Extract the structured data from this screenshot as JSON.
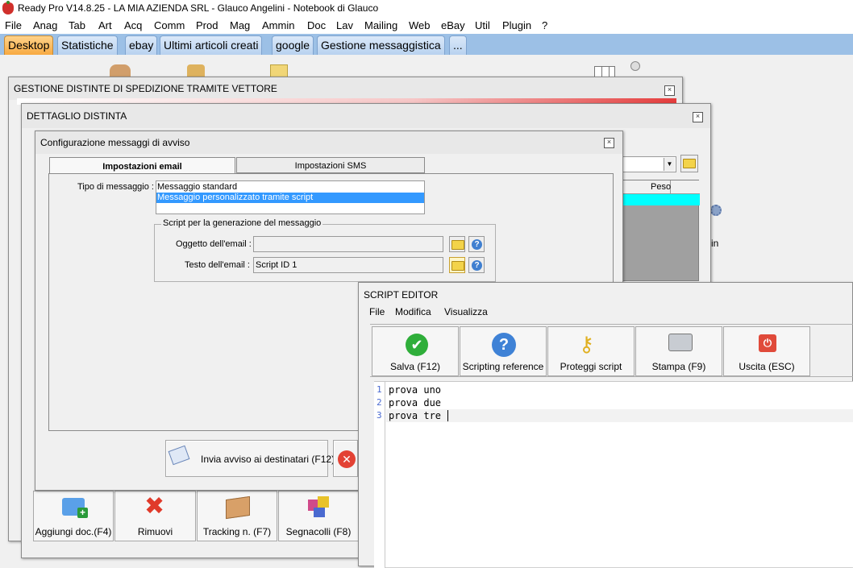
{
  "app": {
    "title": "Ready Pro V14.8.25 - LA MIA AZIENDA SRL - Glauco Angelini - Notebook di Glauco",
    "icon": "strawberry-icon"
  },
  "menu": [
    "File",
    "Anag",
    "Tab",
    "Art",
    "Acq",
    "Comm",
    "Prod",
    "Mag",
    "Ammin",
    "Doc",
    "Lav",
    "Mailing",
    "Web",
    "eBay",
    "Util",
    "Plugin",
    "?"
  ],
  "tabs": [
    "Desktop",
    "Statistiche",
    "ebay",
    "Ultimi articoli creati",
    "google",
    "Gestione messaggistica",
    "..."
  ],
  "win_distinte": {
    "title": "GESTIONE DISTINTE DI SPEDIZIONE TRAMITE VETTORE"
  },
  "win_dettaglio": {
    "title": "DETTAGLIO DISTINTA",
    "column_peso": "Peso",
    "partial_text": "in",
    "bottom_buttons": [
      "Aggiungi doc.(F4)",
      "Rimuovi",
      "Tracking n. (F7)",
      "Segnacolli (F8)"
    ]
  },
  "win_config": {
    "title": "Configurazione messaggi di avviso",
    "tabs": [
      "Impostazioni email",
      "Impostazioni SMS"
    ],
    "tipo_label": "Tipo di messaggio :",
    "tipo_options": [
      "Messaggio standard",
      "Messaggio personalizzato tramite script"
    ],
    "tipo_selected": "Messaggio personalizzato tramite script",
    "script_group": "Script per la generazione del messaggio",
    "oggetto_label": "Oggetto dell'email :",
    "oggetto_value": "",
    "testo_label": "Testo dell'email :",
    "testo_value": "Script ID 1",
    "invia_button": "Invia avviso ai destinatari (F12)"
  },
  "script_editor": {
    "title": "SCRIPT EDITOR",
    "menu": [
      "File",
      "Modifica",
      "Visualizza"
    ],
    "toolbar": [
      "Salva (F12)",
      "Scripting reference",
      "Proteggi script",
      "Stampa (F9)",
      "Uscita (ESC)"
    ],
    "lines": [
      "prova uno",
      "prova due",
      "prova tre"
    ],
    "line_numbers": [
      "1",
      "2",
      "3"
    ]
  },
  "colors": {
    "selection": "#3399ff",
    "cyan_row": "#00ffff",
    "tab_active": "#f7a941",
    "tabstrip": "#9cc0e6"
  }
}
